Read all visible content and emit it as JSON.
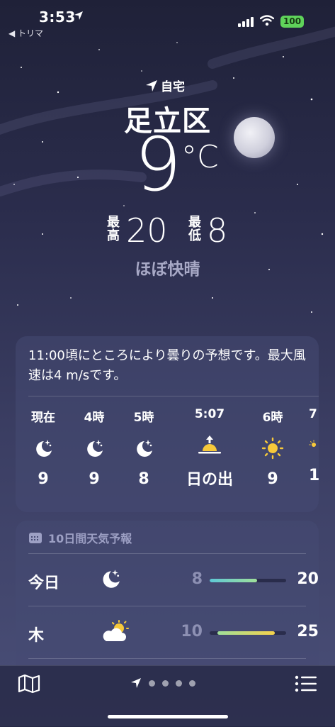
{
  "status_bar": {
    "time": "3:53",
    "back_app": "◀ トリマ",
    "battery": "100"
  },
  "location": {
    "label": "自宅",
    "city": "足立区"
  },
  "current": {
    "temp": "9",
    "unit": "°C",
    "high_label": "最高",
    "high": "20",
    "low_label": "最低",
    "low": "8",
    "condition": "ほぼ快晴"
  },
  "hourly": {
    "summary": "11:00頃にところにより曇りの予想です。最大風速は4 m/sです。",
    "items": [
      {
        "label": "現在",
        "icon": "moon-stars-icon",
        "value": "9"
      },
      {
        "label": "4時",
        "icon": "moon-stars-icon",
        "value": "9"
      },
      {
        "label": "5時",
        "icon": "moon-stars-icon",
        "value": "8"
      },
      {
        "label": "5:07",
        "icon": "sunrise-icon",
        "value": "日の出"
      },
      {
        "label": "6時",
        "icon": "sun-icon",
        "value": "9"
      },
      {
        "label": "7",
        "icon": "sun-icon",
        "value": "1"
      }
    ]
  },
  "forecast": {
    "title": "10日間天気予報",
    "days": [
      {
        "day": "今日",
        "icon": "moon-stars-icon",
        "low": "8",
        "high": "20",
        "range_start": 0.0,
        "range_end": 0.62
      },
      {
        "day": "木",
        "icon": "partly-cloudy-icon",
        "low": "10",
        "high": "25",
        "range_start": 0.1,
        "range_end": 0.85
      }
    ]
  },
  "tabbar": {
    "icons": [
      "map-icon",
      "location-arrow-icon",
      "list-icon"
    ],
    "page_count": 4
  },
  "colors": {
    "accent_sun": "#f7c93a",
    "battery": "#5fd35a",
    "bar_today_start": "#5ec8d6",
    "bar_today_end": "#9fe09a",
    "bar_thu_start": "#9fe09a",
    "bar_thu_end": "#f6d24b"
  }
}
